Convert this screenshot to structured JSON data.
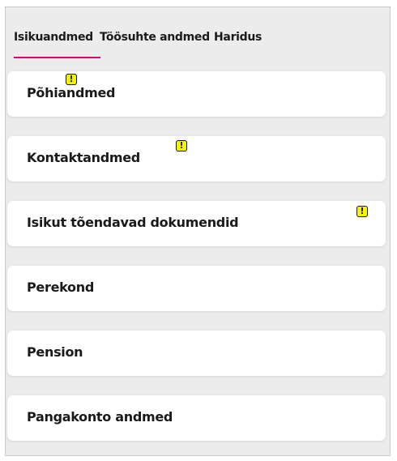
{
  "tabs": [
    {
      "label": "Isikuandmed",
      "active": true
    },
    {
      "label": "Töösuhte andmed",
      "active": false
    },
    {
      "label": "Haridus",
      "active": false
    }
  ],
  "accent_color": "#d10a79",
  "warning_color": "#f5f500",
  "warning_icon": "exclamation-warning-icon",
  "warning_glyph": "!",
  "sections": [
    {
      "label": "Põhiandmed",
      "warning": true
    },
    {
      "label": "Kontaktandmed",
      "warning": true
    },
    {
      "label": "Isikut tõendavad dokumendid",
      "warning": true
    },
    {
      "label": "Perekond",
      "warning": false
    },
    {
      "label": "Pension",
      "warning": false
    },
    {
      "label": "Pangakonto andmed",
      "warning": false
    }
  ]
}
